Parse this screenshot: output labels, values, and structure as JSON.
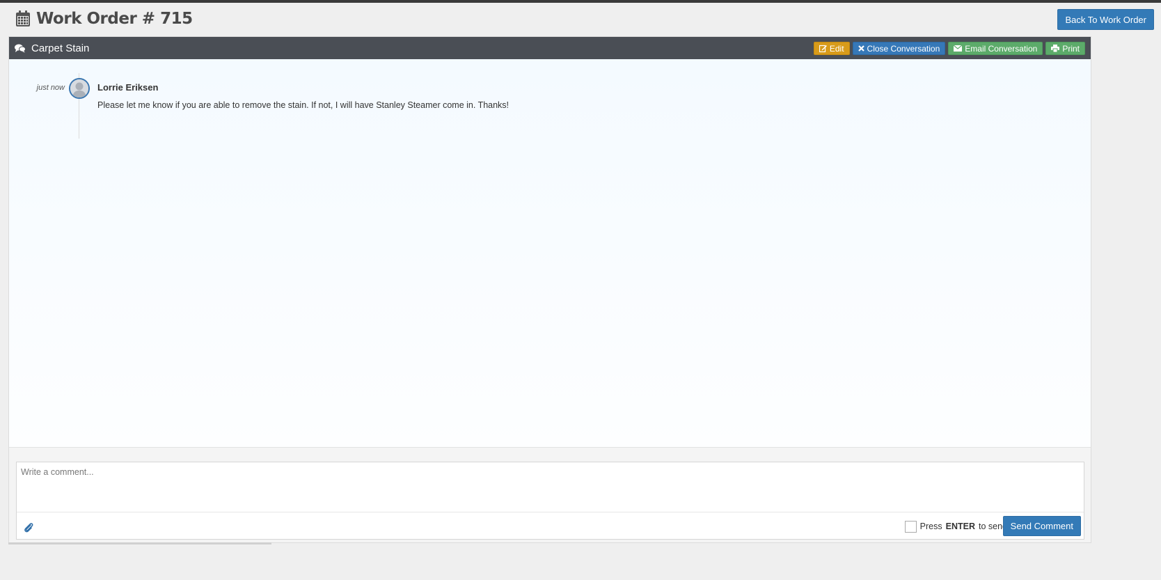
{
  "header": {
    "title": "Work Order # 715",
    "back_button": "Back To Work Order",
    "icon": "calendar-icon"
  },
  "conversation": {
    "title": "Carpet Stain",
    "icon": "comments-icon",
    "actions": {
      "edit": "Edit",
      "close": "Close Conversation",
      "email": "Email Conversation",
      "print": "Print"
    },
    "messages": [
      {
        "time": "just now",
        "author": "Lorrie Eriksen",
        "text": "Please let me know if you are able to remove the stain. If not, I will have Stanley Steamer come in. Thanks!"
      }
    ]
  },
  "composer": {
    "placeholder": "Write a comment...",
    "press_label": "Press",
    "enter_key": "ENTER",
    "to_send_label": "to send",
    "send_button": "Send Comment",
    "enter_to_send_checked": false
  },
  "colors": {
    "primary": "#337ab7",
    "warning": "#d89b1a",
    "success": "#5cab6a",
    "panel_header": "#4a4e55"
  }
}
